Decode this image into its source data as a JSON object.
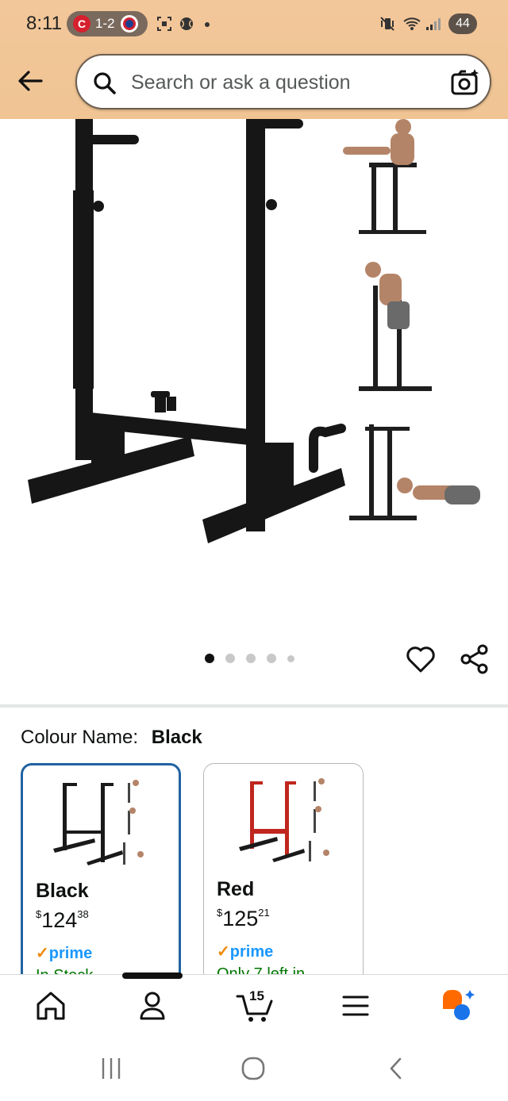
{
  "status_bar": {
    "time": "8:11",
    "score_team_left": "C",
    "score": "1-2",
    "battery": "44"
  },
  "header": {
    "search_placeholder": "Search or ask a question"
  },
  "gallery": {
    "dot_count": 5,
    "active_dot_index": 0
  },
  "variation": {
    "label": "Colour Name:",
    "selected_value": "Black",
    "options": [
      {
        "name": "Black",
        "currency": "$",
        "price_whole": "124",
        "price_fraction": "38",
        "prime_check": "✓",
        "prime_label": "prime",
        "availability": "In Stock",
        "selected": true
      },
      {
        "name": "Red",
        "currency": "$",
        "price_whole": "125",
        "price_fraction": "21",
        "prime_check": "✓",
        "prime_label": "prime",
        "availability": "Only 7 left in",
        "selected": false
      }
    ]
  },
  "bottom_nav": {
    "cart_count": "15"
  },
  "colors": {
    "header_bg": "#f0c493",
    "selected_border": "#2162a1",
    "prime_blue": "#1a98ff",
    "stock_green": "#007600"
  }
}
